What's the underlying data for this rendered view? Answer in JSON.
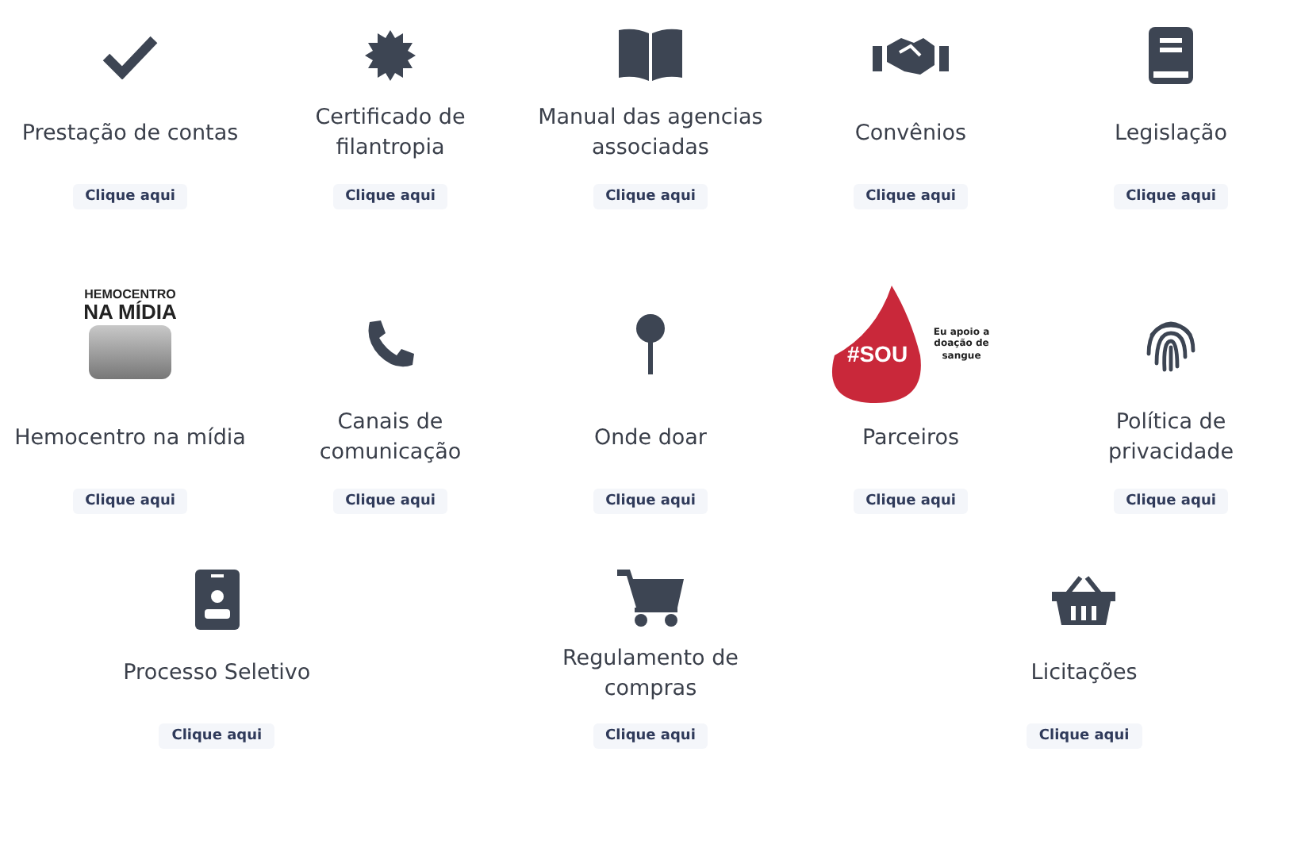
{
  "rows": [
    {
      "items": [
        {
          "kind": "check",
          "title": "Prestação de contas",
          "link": "Clique aqui"
        },
        {
          "kind": "badge",
          "title": "Certificado de filantropia",
          "link": "Clique aqui"
        },
        {
          "kind": "book",
          "title": "Manual das agencias associadas",
          "link": "Clique aqui"
        },
        {
          "kind": "handshake",
          "title": "Convênios",
          "link": "Clique aqui"
        },
        {
          "kind": "bookmark",
          "title": "Legislação",
          "link": "Clique aqui"
        }
      ]
    },
    {
      "items": [
        {
          "kind": "media",
          "logo": [
            "HEMOCENTRO",
            "NA MÍDIA"
          ],
          "title": "Hemocentro na mídia",
          "link": "Clique aqui"
        },
        {
          "kind": "phone",
          "title": "Canais de comunicação",
          "link": "Clique aqui"
        },
        {
          "kind": "pin",
          "title": "Onde doar",
          "link": "Clique aqui"
        },
        {
          "kind": "drop",
          "logo": [
            "#SOU",
            "Eu apoio a doação de sangue"
          ],
          "title": "Parceiros",
          "link": "Clique aqui"
        },
        {
          "kind": "fingerprint",
          "title": "Política de privacidade",
          "link": "Clique aqui"
        }
      ]
    },
    {
      "items": [
        {
          "kind": "idcard",
          "title": "Processo Seletivo",
          "link": "Clique aqui"
        },
        {
          "kind": "cart",
          "title": "Regulamento de compras",
          "link": "Clique aqui"
        },
        {
          "kind": "basket",
          "title": "Licitações",
          "link": "Clique aqui"
        }
      ]
    }
  ]
}
